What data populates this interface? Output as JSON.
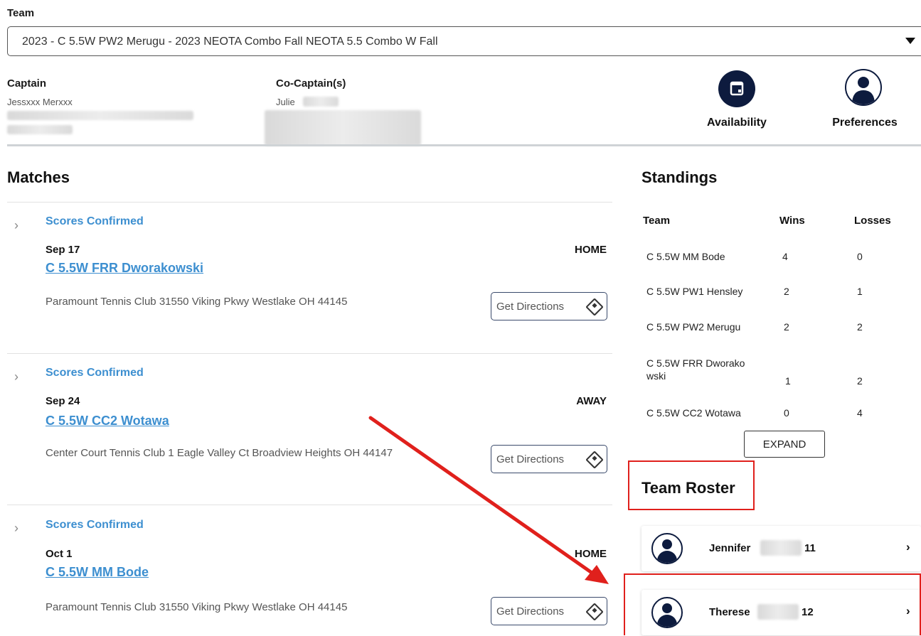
{
  "team_selector": {
    "label": "Team",
    "value": "2023 - C 5.5W PW2 Merugu - 2023 NEOTA Combo Fall NEOTA 5.5 Combo W Fall"
  },
  "captain": {
    "label": "Captain",
    "name": "Jessxxx Merxxx"
  },
  "co_captain": {
    "label": "Co-Captain(s)",
    "name": "Julie"
  },
  "actions": {
    "availability": {
      "label": "Availability",
      "icon": "calendar-icon"
    },
    "preferences": {
      "label": "Preferences",
      "icon": "person-icon"
    }
  },
  "matches": {
    "title": "Matches",
    "items": [
      {
        "status": "Scores Confirmed",
        "date": "Sep 17",
        "opponent": "C 5.5W FRR Dworakowski",
        "home_away": "HOME",
        "location": "Paramount Tennis Club 31550 Viking Pkwy Westlake OH 44145",
        "directions_label": "Get Directions"
      },
      {
        "status": "Scores Confirmed",
        "date": "Sep 24",
        "opponent": "C 5.5W CC2 Wotawa",
        "home_away": "AWAY",
        "location": "Center Court Tennis Club 1 Eagle Valley Ct Broadview Heights OH 44147",
        "directions_label": "Get Directions"
      },
      {
        "status": "Scores Confirmed",
        "date": "Oct 1",
        "opponent": "C 5.5W MM Bode",
        "home_away": "HOME",
        "location": "Paramount Tennis Club 31550 Viking Pkwy Westlake OH 44145",
        "directions_label": "Get Directions"
      }
    ]
  },
  "standings": {
    "title": "Standings",
    "columns": [
      "Team",
      "Wins",
      "Losses"
    ],
    "rows": [
      {
        "team": "C 5.5W MM Bode",
        "wins": "4",
        "losses": "0"
      },
      {
        "team": "C 5.5W PW1 Hensley",
        "wins": "2",
        "losses": "1"
      },
      {
        "team": "C 5.5W PW2 Merugu",
        "wins": "2",
        "losses": "2"
      },
      {
        "team_line1": "C 5.5W FRR Dworako",
        "team_line2": "wski",
        "wins": "1",
        "losses": "2"
      },
      {
        "team": "C 5.5W CC2 Wotawa",
        "wins": "0",
        "losses": "4"
      }
    ],
    "expand_label": "EXPAND"
  },
  "roster": {
    "title": "Team Roster",
    "players": [
      {
        "first_name": "Jennifer",
        "number": "11"
      },
      {
        "first_name": "Therese",
        "number": "12"
      }
    ]
  },
  "colors": {
    "accent_blue": "#3d8fd0",
    "navy": "#0d1b3e",
    "annotation_red": "#e0201c"
  }
}
